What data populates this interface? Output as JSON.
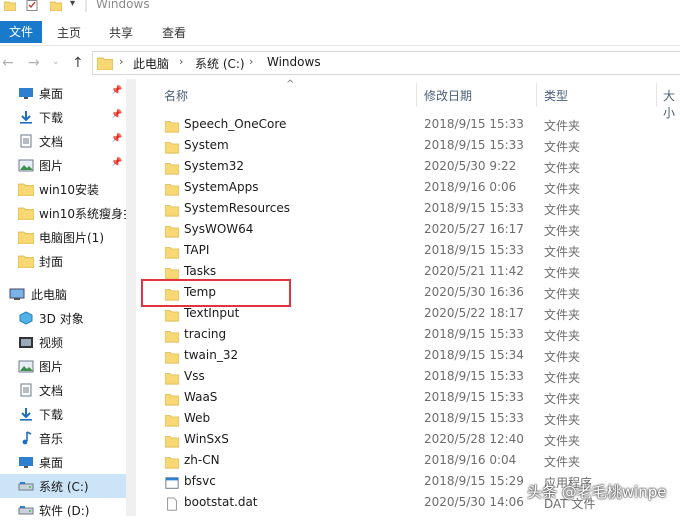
{
  "window": {
    "title": "Windows"
  },
  "ribbon": {
    "tabs": [
      "文件",
      "主页",
      "共享",
      "查看"
    ]
  },
  "address": {
    "crumbs": [
      "此电脑",
      "系统 (C:)",
      "Windows"
    ]
  },
  "nav": {
    "quick_access": [
      {
        "label": "桌面",
        "icon": "desktop-icon",
        "pinned": true
      },
      {
        "label": "下载",
        "icon": "download-icon",
        "pinned": true
      },
      {
        "label": "文档",
        "icon": "document-icon",
        "pinned": true
      },
      {
        "label": "图片",
        "icon": "picture-icon",
        "pinned": true
      },
      {
        "label": "win10安装",
        "icon": "folder-icon",
        "pinned": false
      },
      {
        "label": "win10系统瘦身扌",
        "icon": "folder-icon",
        "pinned": false
      },
      {
        "label": "电脑图片(1)",
        "icon": "folder-icon",
        "pinned": false
      },
      {
        "label": "封面",
        "icon": "folder-icon",
        "pinned": false
      }
    ],
    "this_pc": {
      "label": "此电脑",
      "icon": "computer-icon"
    },
    "pc_items": [
      {
        "label": "3D 对象",
        "icon": "cube-icon"
      },
      {
        "label": "视频",
        "icon": "video-icon"
      },
      {
        "label": "图片",
        "icon": "picture-icon"
      },
      {
        "label": "文档",
        "icon": "document-icon"
      },
      {
        "label": "下载",
        "icon": "download-icon"
      },
      {
        "label": "音乐",
        "icon": "music-icon"
      },
      {
        "label": "桌面",
        "icon": "desktop-icon"
      },
      {
        "label": "系统 (C:)",
        "icon": "drive-icon",
        "selected": true
      },
      {
        "label": "软件 (D:)",
        "icon": "drive-icon"
      }
    ]
  },
  "columns": {
    "name": "名称",
    "modified": "修改日期",
    "type": "类型",
    "size": "大小"
  },
  "files": [
    {
      "name": "Speech_OneCore",
      "modified": "2018/9/15 15:33",
      "type": "文件夹",
      "kind": "folder"
    },
    {
      "name": "System",
      "modified": "2018/9/15 15:33",
      "type": "文件夹",
      "kind": "folder"
    },
    {
      "name": "System32",
      "modified": "2020/5/30 9:22",
      "type": "文件夹",
      "kind": "folder"
    },
    {
      "name": "SystemApps",
      "modified": "2018/9/16 0:06",
      "type": "文件夹",
      "kind": "folder"
    },
    {
      "name": "SystemResources",
      "modified": "2018/9/15 15:33",
      "type": "文件夹",
      "kind": "folder"
    },
    {
      "name": "SysWOW64",
      "modified": "2020/5/27 16:17",
      "type": "文件夹",
      "kind": "folder"
    },
    {
      "name": "TAPI",
      "modified": "2018/9/15 15:33",
      "type": "文件夹",
      "kind": "folder"
    },
    {
      "name": "Tasks",
      "modified": "2020/5/21 11:42",
      "type": "文件夹",
      "kind": "folder"
    },
    {
      "name": "Temp",
      "modified": "2020/5/30 16:36",
      "type": "文件夹",
      "kind": "folder"
    },
    {
      "name": "TextInput",
      "modified": "2020/5/22 18:17",
      "type": "文件夹",
      "kind": "folder"
    },
    {
      "name": "tracing",
      "modified": "2018/9/15 15:33",
      "type": "文件夹",
      "kind": "folder"
    },
    {
      "name": "twain_32",
      "modified": "2018/9/15 15:34",
      "type": "文件夹",
      "kind": "folder"
    },
    {
      "name": "Vss",
      "modified": "2018/9/15 15:33",
      "type": "文件夹",
      "kind": "folder"
    },
    {
      "name": "WaaS",
      "modified": "2018/9/15 15:33",
      "type": "文件夹",
      "kind": "folder"
    },
    {
      "name": "Web",
      "modified": "2018/9/15 15:33",
      "type": "文件夹",
      "kind": "folder"
    },
    {
      "name": "WinSxS",
      "modified": "2020/5/28 12:40",
      "type": "文件夹",
      "kind": "folder"
    },
    {
      "name": "zh-CN",
      "modified": "2018/9/16 0:04",
      "type": "文件夹",
      "kind": "folder"
    },
    {
      "name": "bfsvc",
      "modified": "2018/9/15 15:29",
      "type": "应用程序",
      "kind": "exe"
    },
    {
      "name": "bootstat.dat",
      "modified": "2020/5/30 14:06",
      "type": "DAT 文件",
      "kind": "file"
    }
  ],
  "annotation": {
    "highlighted_item": "Temp",
    "color": "#e2343e"
  },
  "watermark": "头条 @老毛桃winpe",
  "colors": {
    "accent": "#1979ca",
    "folder": "#f8d775",
    "selection": "#cce4f7"
  }
}
